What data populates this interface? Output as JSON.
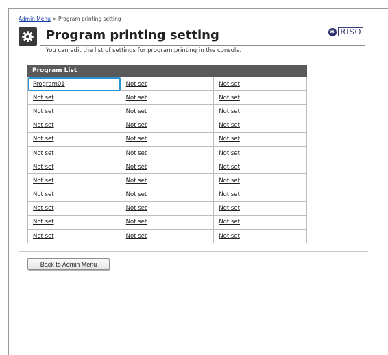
{
  "breadcrumb": {
    "root_label": "Admin Menu",
    "separator": " > ",
    "current_label": "Program printing setting"
  },
  "header": {
    "title": "Program printing setting",
    "subtitle": "You can edit the list of settings for program printing in the console.",
    "title_icon": "gear-icon",
    "logo_text": "RISO"
  },
  "program_list": {
    "header_label": "Program List",
    "rows": [
      [
        "Program01",
        "Not set",
        "Not set"
      ],
      [
        "Not set",
        "Not set",
        "Not set"
      ],
      [
        "Not set",
        "Not set",
        "Not set"
      ],
      [
        "Not set",
        "Not set",
        "Not set"
      ],
      [
        "Not set",
        "Not set",
        "Not set"
      ],
      [
        "Not set",
        "Not set",
        "Not set"
      ],
      [
        "Not set",
        "Not set",
        "Not set"
      ],
      [
        "Not set",
        "Not set",
        "Not set"
      ],
      [
        "Not set",
        "Not set",
        "Not set"
      ],
      [
        "Not set",
        "Not set",
        "Not set"
      ],
      [
        "Not set",
        "Not set",
        "Not set"
      ],
      [
        "Not set",
        "Not set",
        "Not set"
      ]
    ],
    "selected_cell": "Program01"
  },
  "footer": {
    "back_button_label": "Back to Admin Menu"
  },
  "colors": {
    "accent_selection": "#2a93d5",
    "list_header_bg": "#5a5a5a",
    "link": "#1a3fa8"
  }
}
